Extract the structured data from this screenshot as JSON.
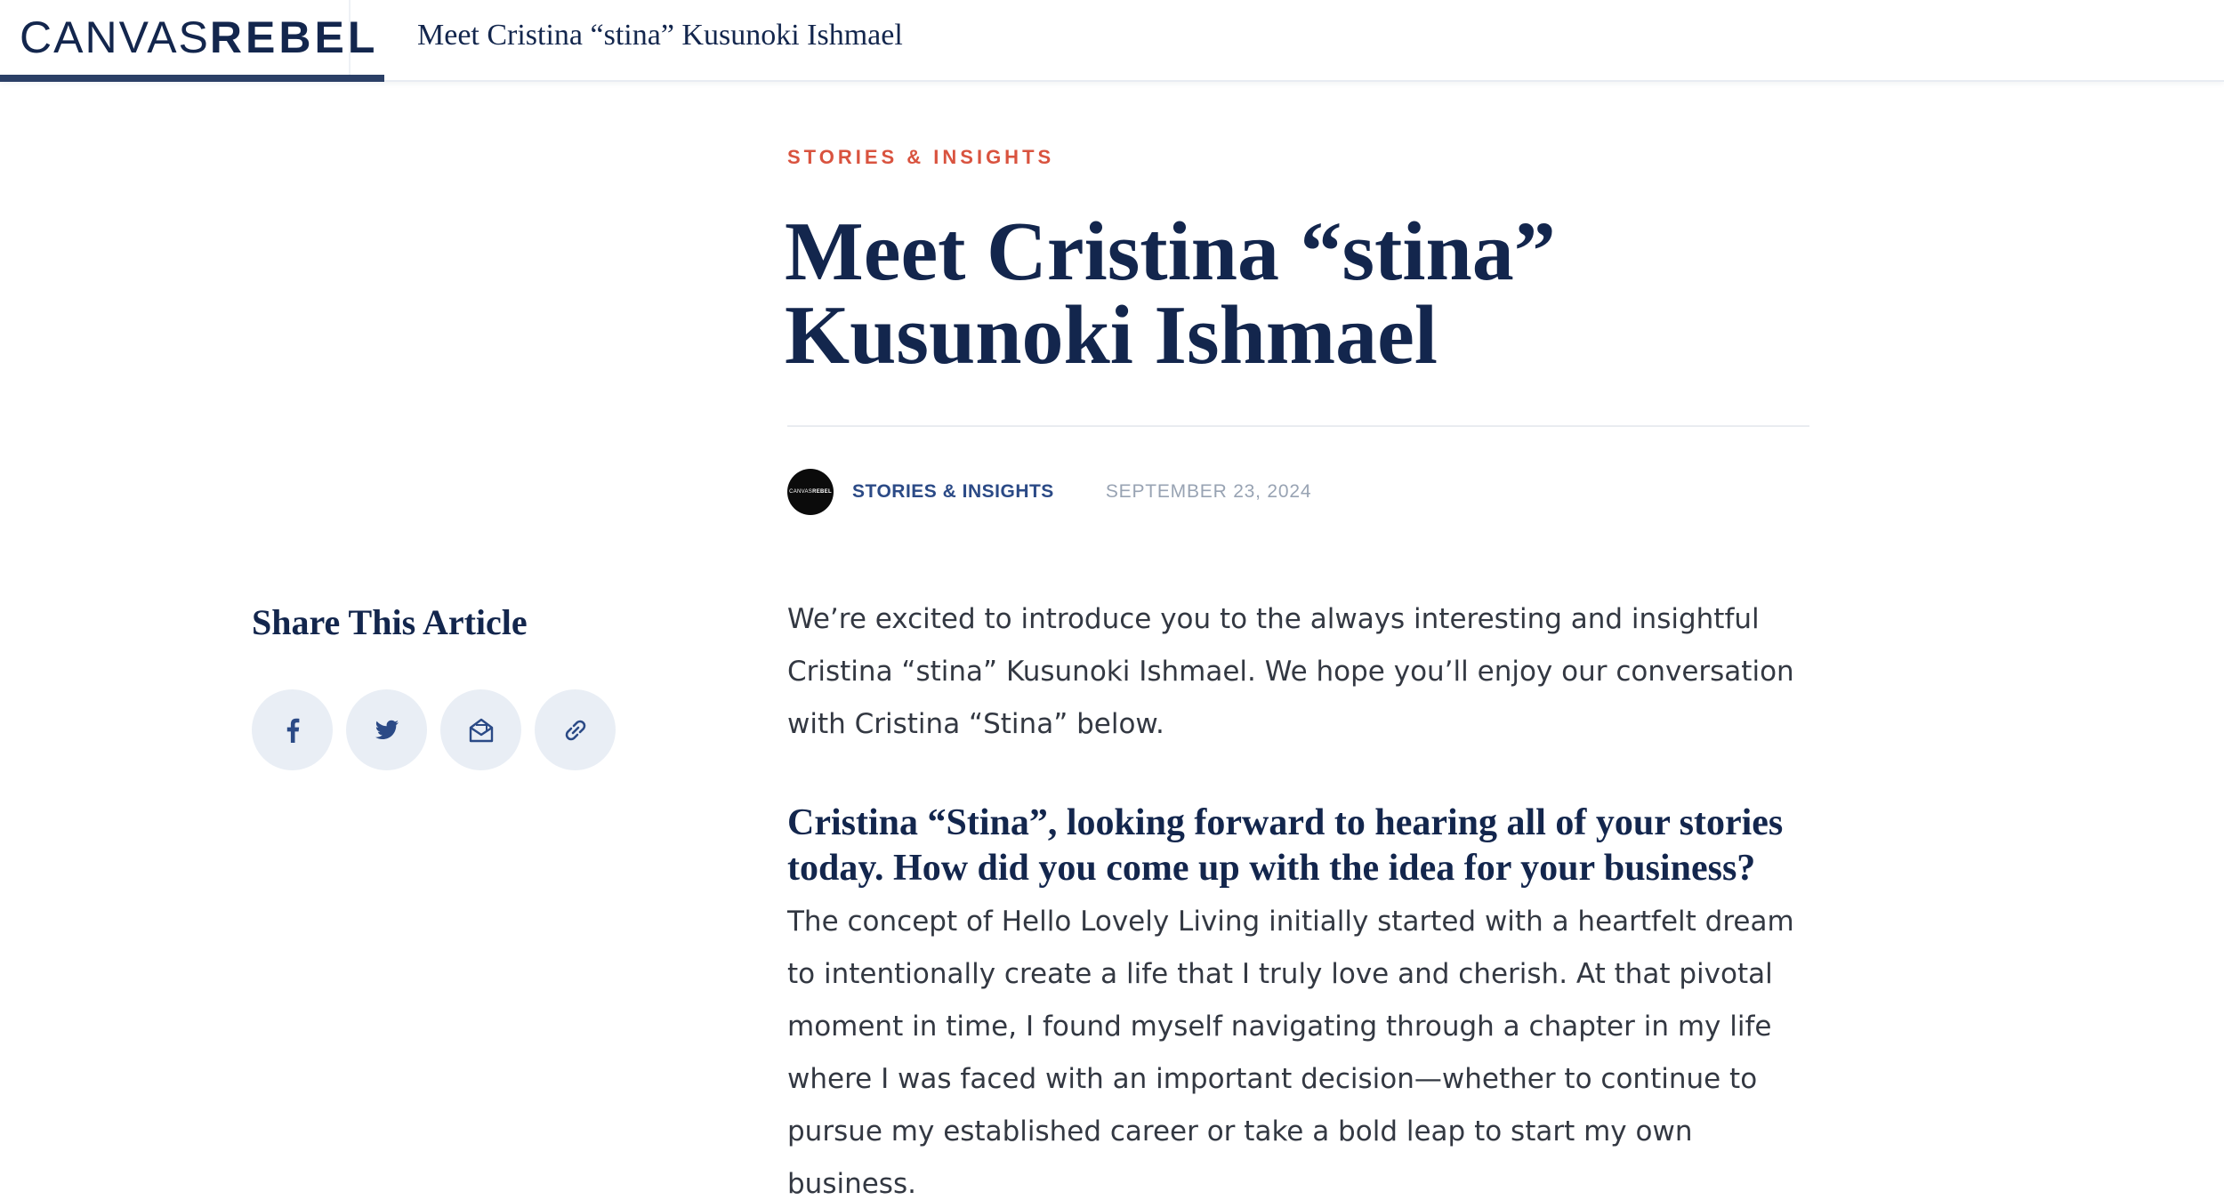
{
  "header": {
    "logo_light": "CANVAS",
    "logo_bold": "REBEL",
    "title": "Meet Cristina “stina” Kusunoki Ishmael"
  },
  "article": {
    "category": "STORIES & INSIGHTS",
    "title": "Meet Cristina “stina” Kusunoki Ishmael",
    "byline": {
      "avatar_text_light": "CANVAS",
      "avatar_text_bold": "REBEL",
      "author": "STORIES & INSIGHTS",
      "date": "SEPTEMBER 23, 2024"
    },
    "intro": "We’re excited to introduce you to the always interesting and insightful Cristina “stina” Kusunoki Ishmael.  We hope you’ll enjoy our conversation with Cristina “Stina” below.",
    "question": "Cristina “Stina”, looking forward to hearing all of your stories today. How did you come up with the idea for your business?",
    "answer": "The concept of Hello Lovely Living initially started with a heartfelt dream to intentionally create a life that I truly love and cherish. At that pivotal moment in time, I found myself navigating through a chapter in my life where I was faced with an important decision—whether to continue to pursue my established career or take a bold leap to start my own business."
  },
  "share": {
    "heading": "Share This Article",
    "buttons": [
      {
        "icon": "facebook-icon"
      },
      {
        "icon": "twitter-icon"
      },
      {
        "icon": "email-icon"
      },
      {
        "icon": "link-icon"
      }
    ]
  },
  "colors": {
    "navy": "#13264d",
    "accent_red": "#d9533f",
    "author_blue": "#2b4a86",
    "date_gray": "#98a3b3",
    "share_bg": "#e9eef5"
  }
}
